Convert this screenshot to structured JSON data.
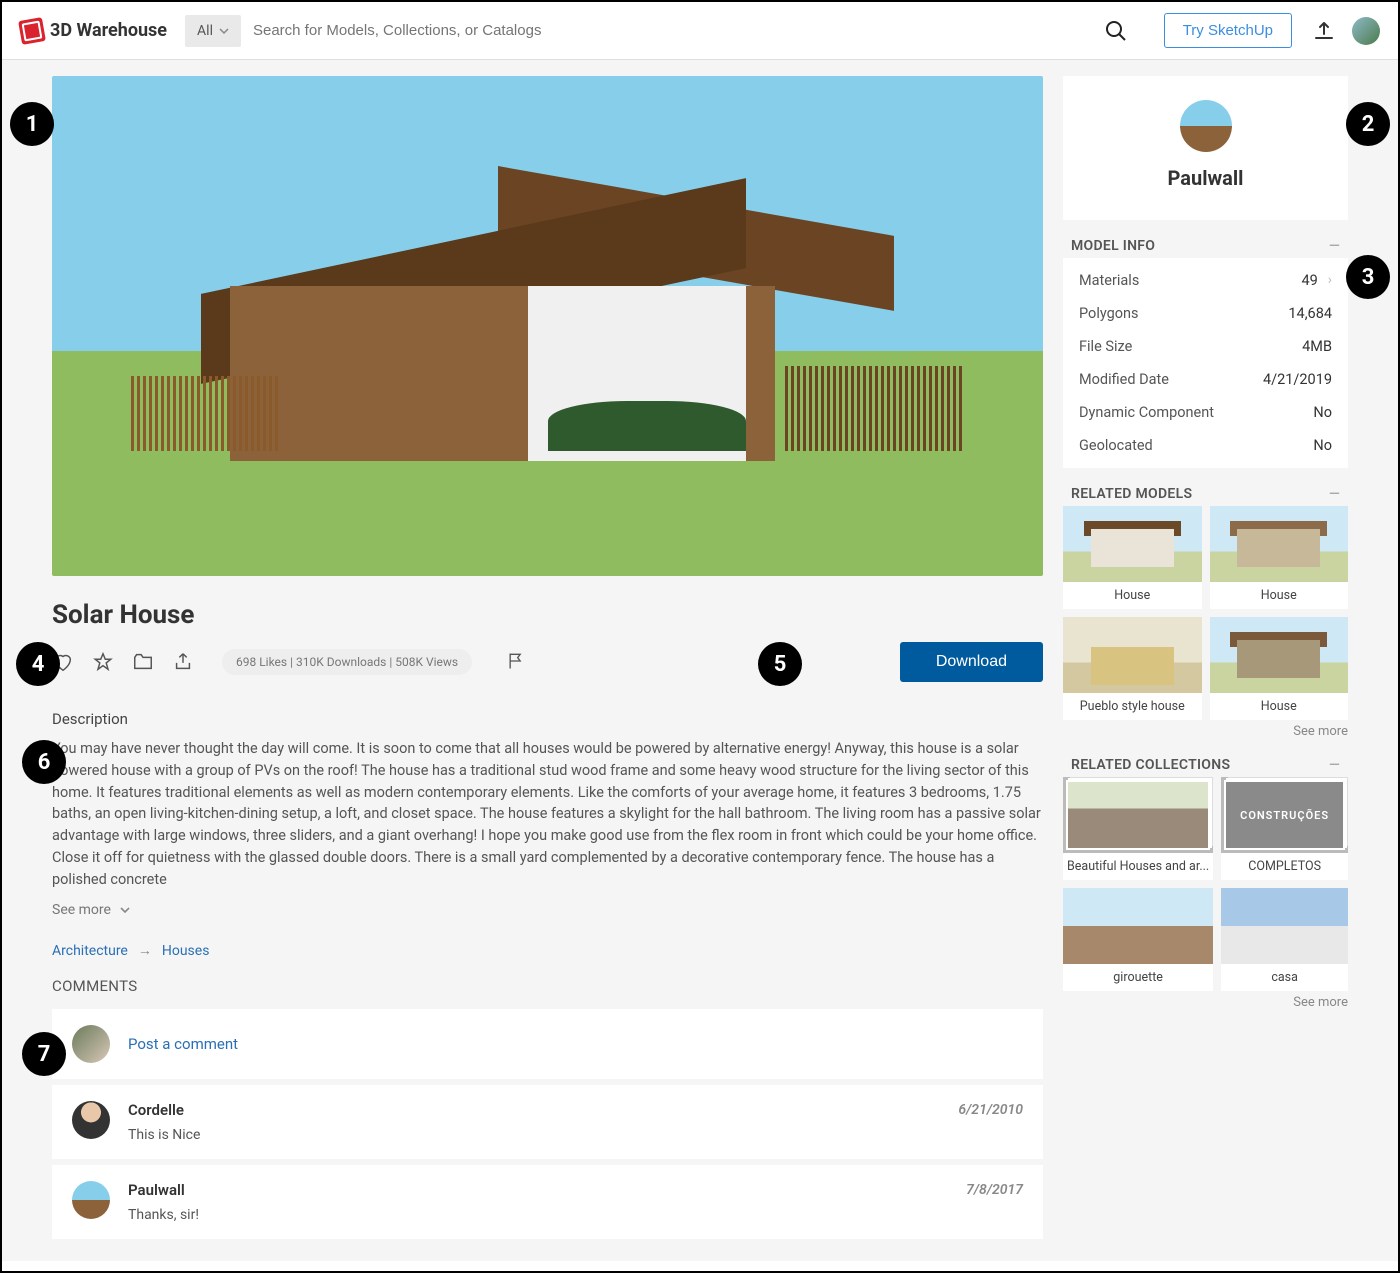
{
  "header": {
    "brand": "3D Warehouse",
    "filter": "All",
    "search_placeholder": "Search for Models, Collections, or Catalogs",
    "try_button": "Try SketchUp"
  },
  "model": {
    "title": "Solar House",
    "stats": "698 Likes  |  310K Downloads  |  508K Views",
    "download_button": "Download",
    "description_heading": "Description",
    "description": "You may have never thought the day will come. It is soon to come that all houses would be powered by alternative energy! Anyway, this house is a solar powered house with a group of PVs on the roof! The house has a traditional stud wood frame and some heavy wood structure for the living sector of this home. It features traditional elements as well as modern contemporary elements. Like the comforts of your average home, it features 3 bedrooms, 1.75 baths, an open living-kitchen-dining setup, a loft, and closet space. The house features a skylight for the hall bathroom. The living room has a passive solar advantage with large windows, three sliders, and a giant overhang! I hope you make good use from the flex room in front which could be your home office. Close it off for quietness with the glassed double doors. There is a small yard complemented by a decorative contemporary fence. The house has a polished concrete",
    "see_more": "See more"
  },
  "breadcrumb": {
    "root": "Architecture",
    "leaf": "Houses"
  },
  "comments": {
    "heading": "COMMENTS",
    "post_prompt": "Post a comment",
    "items": [
      {
        "author": "Cordelle",
        "date": "6/21/2010",
        "text": "This is Nice"
      },
      {
        "author": "Paulwall",
        "date": "7/8/2017",
        "text": "Thanks, sir!"
      }
    ]
  },
  "author": {
    "name": "Paulwall"
  },
  "model_info": {
    "heading": "MODEL INFO",
    "rows": [
      {
        "label": "Materials",
        "value": "49",
        "chevron": true
      },
      {
        "label": "Polygons",
        "value": "14,684"
      },
      {
        "label": "File Size",
        "value": "4MB"
      },
      {
        "label": "Modified Date",
        "value": "4/21/2019"
      },
      {
        "label": "Dynamic Component",
        "value": "No"
      },
      {
        "label": "Geolocated",
        "value": "No"
      }
    ]
  },
  "related_models": {
    "heading": "RELATED MODELS",
    "items": [
      {
        "label": "House"
      },
      {
        "label": "House"
      },
      {
        "label": "Pueblo style house"
      },
      {
        "label": "House"
      }
    ],
    "see_more": "See more"
  },
  "related_collections": {
    "heading": "RELATED COLLECTIONS",
    "items": [
      {
        "label": "Beautiful Houses and ar..."
      },
      {
        "label": "COMPLETOS",
        "overlay": "CONSTRUÇÕES"
      },
      {
        "label": "girouette"
      },
      {
        "label": "casa"
      }
    ],
    "see_more": "See more"
  },
  "callouts": [
    "1",
    "2",
    "3",
    "4",
    "5",
    "6",
    "7"
  ]
}
